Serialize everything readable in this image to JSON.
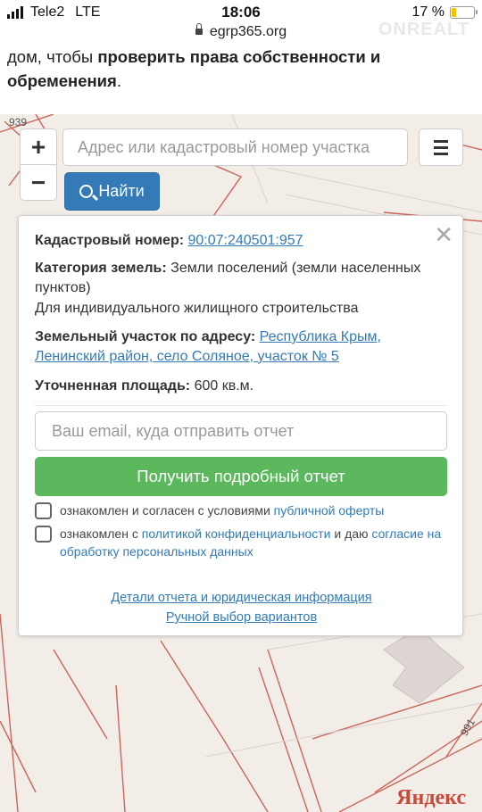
{
  "status": {
    "carrier": "Tele2",
    "network": "LTE",
    "time": "18:06",
    "url": "egrp365.org",
    "battery": "17 %",
    "watermark": "ONREALT"
  },
  "intro": {
    "text_before": "дом, чтобы ",
    "bold": "проверить права собственности и обременения",
    "text_after": "."
  },
  "map": {
    "zoom_in": "+",
    "zoom_out": "−",
    "search_placeholder": "Адрес или кадастровый номер участка",
    "find_label": "Найти",
    "label_939": "939",
    "label_991": "991",
    "provider_logo": "Яндекс"
  },
  "card": {
    "close": "✕",
    "cadastral_label": "Кадастровый номер:",
    "cadastral_value": "90:07:240501:957",
    "category_label": "Категория земель:",
    "category_value": "Земли поселений (земли населенных пунктов)",
    "usage": "Для индивидуального жилищного строительства",
    "address_label": "Земельный участок по адресу:",
    "address_value": "Республика Крым, Ленинский район, село Соляное, участок № 5",
    "area_label": "Уточненная площадь:",
    "area_value": "600 кв.м.",
    "email_placeholder": "Ваш email, куда отправить отчет",
    "get_report": "Получить подробный отчет",
    "consent1_text": "ознакомлен и согласен с условиями ",
    "consent1_link": "публичной оферты",
    "consent2_text1": "ознакомлен с ",
    "consent2_link1": "политикой конфиденциальности",
    "consent2_text2": " и даю ",
    "consent2_link2": "согласие на обработку персональных данных",
    "details_link": "Детали отчета и юридическая информация",
    "manual_link": "Ручной выбор вариантов"
  }
}
